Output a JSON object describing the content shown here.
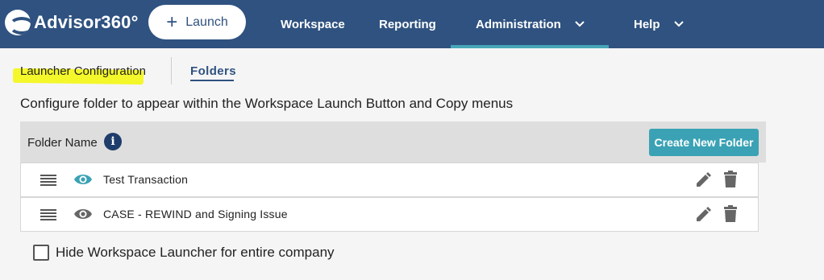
{
  "header": {
    "logo_text": "Advisor360°",
    "launch_label": "Launch",
    "nav": [
      {
        "label": "Workspace"
      },
      {
        "label": "Reporting"
      },
      {
        "label": "Administration"
      },
      {
        "label": "Help"
      }
    ],
    "active_nav": "Administration",
    "colors": {
      "bar": "#2f5280",
      "accent": "#46a7b7"
    }
  },
  "tabs": {
    "launcher_configuration": "Launcher Configuration",
    "folders": "Folders"
  },
  "description": "Configure folder to appear within the Workspace Launch Button and Copy menus",
  "table": {
    "header_label": "Folder Name",
    "info_icon": "i",
    "create_button": "Create New Folder",
    "rows": [
      {
        "label": "Test Transaction",
        "visible": true
      },
      {
        "label": "CASE - REWIND and Signing Issue",
        "visible": false
      }
    ]
  },
  "hide_launcher": {
    "label": "Hide Workspace Launcher for entire company",
    "checked": false
  }
}
